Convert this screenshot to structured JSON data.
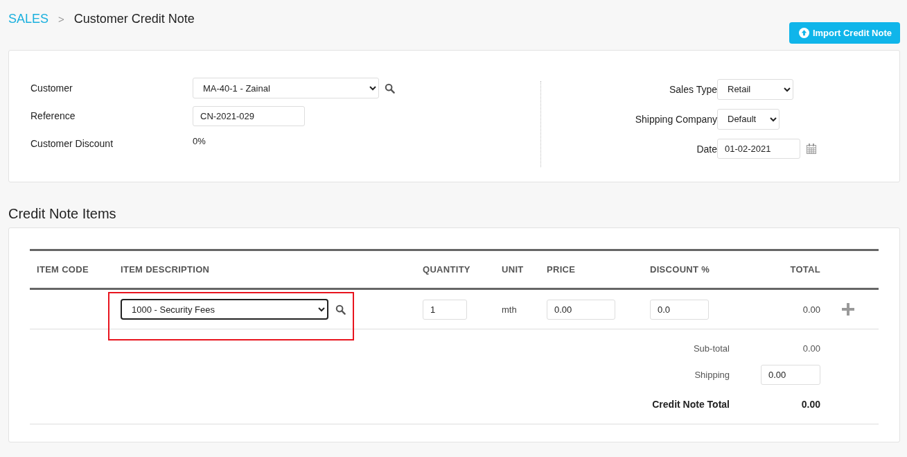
{
  "breadcrumb": {
    "parent": "SALES",
    "separator": ">",
    "current": "Customer Credit Note"
  },
  "import_button": {
    "label": "Import Credit Note"
  },
  "header_form": {
    "left": [
      {
        "label": "Customer",
        "kind": "select",
        "value": "MA-40-1 - Zainal",
        "search": true
      },
      {
        "label": "Reference",
        "kind": "input",
        "value": "CN-2021-029"
      },
      {
        "label": "Customer Discount",
        "kind": "text",
        "value": "0%"
      }
    ],
    "right": [
      {
        "label": "Sales Type",
        "kind": "select",
        "value": "Retail"
      },
      {
        "label": "Shipping Company",
        "kind": "select",
        "value": "Default"
      },
      {
        "label": "Date",
        "kind": "date",
        "value": "01-02-2021"
      }
    ]
  },
  "items_section": {
    "title": "Credit Note Items",
    "columns": [
      "ITEM CODE",
      "ITEM DESCRIPTION",
      "QUANTITY",
      "UNIT",
      "PRICE",
      "DISCOUNT %",
      "TOTAL"
    ],
    "rows": [
      {
        "description": "1000 - Security Fees",
        "highlighted": true,
        "quantity": "1",
        "unit": "mth",
        "price": "0.00",
        "discount": "0.0",
        "total": "0.00"
      }
    ],
    "subtotal": {
      "label": "Sub-total",
      "value": "0.00"
    },
    "shipping": {
      "label": "Shipping",
      "value": "0.00"
    },
    "grand_total": {
      "label": "Credit Note Total",
      "value": "0.00"
    }
  }
}
